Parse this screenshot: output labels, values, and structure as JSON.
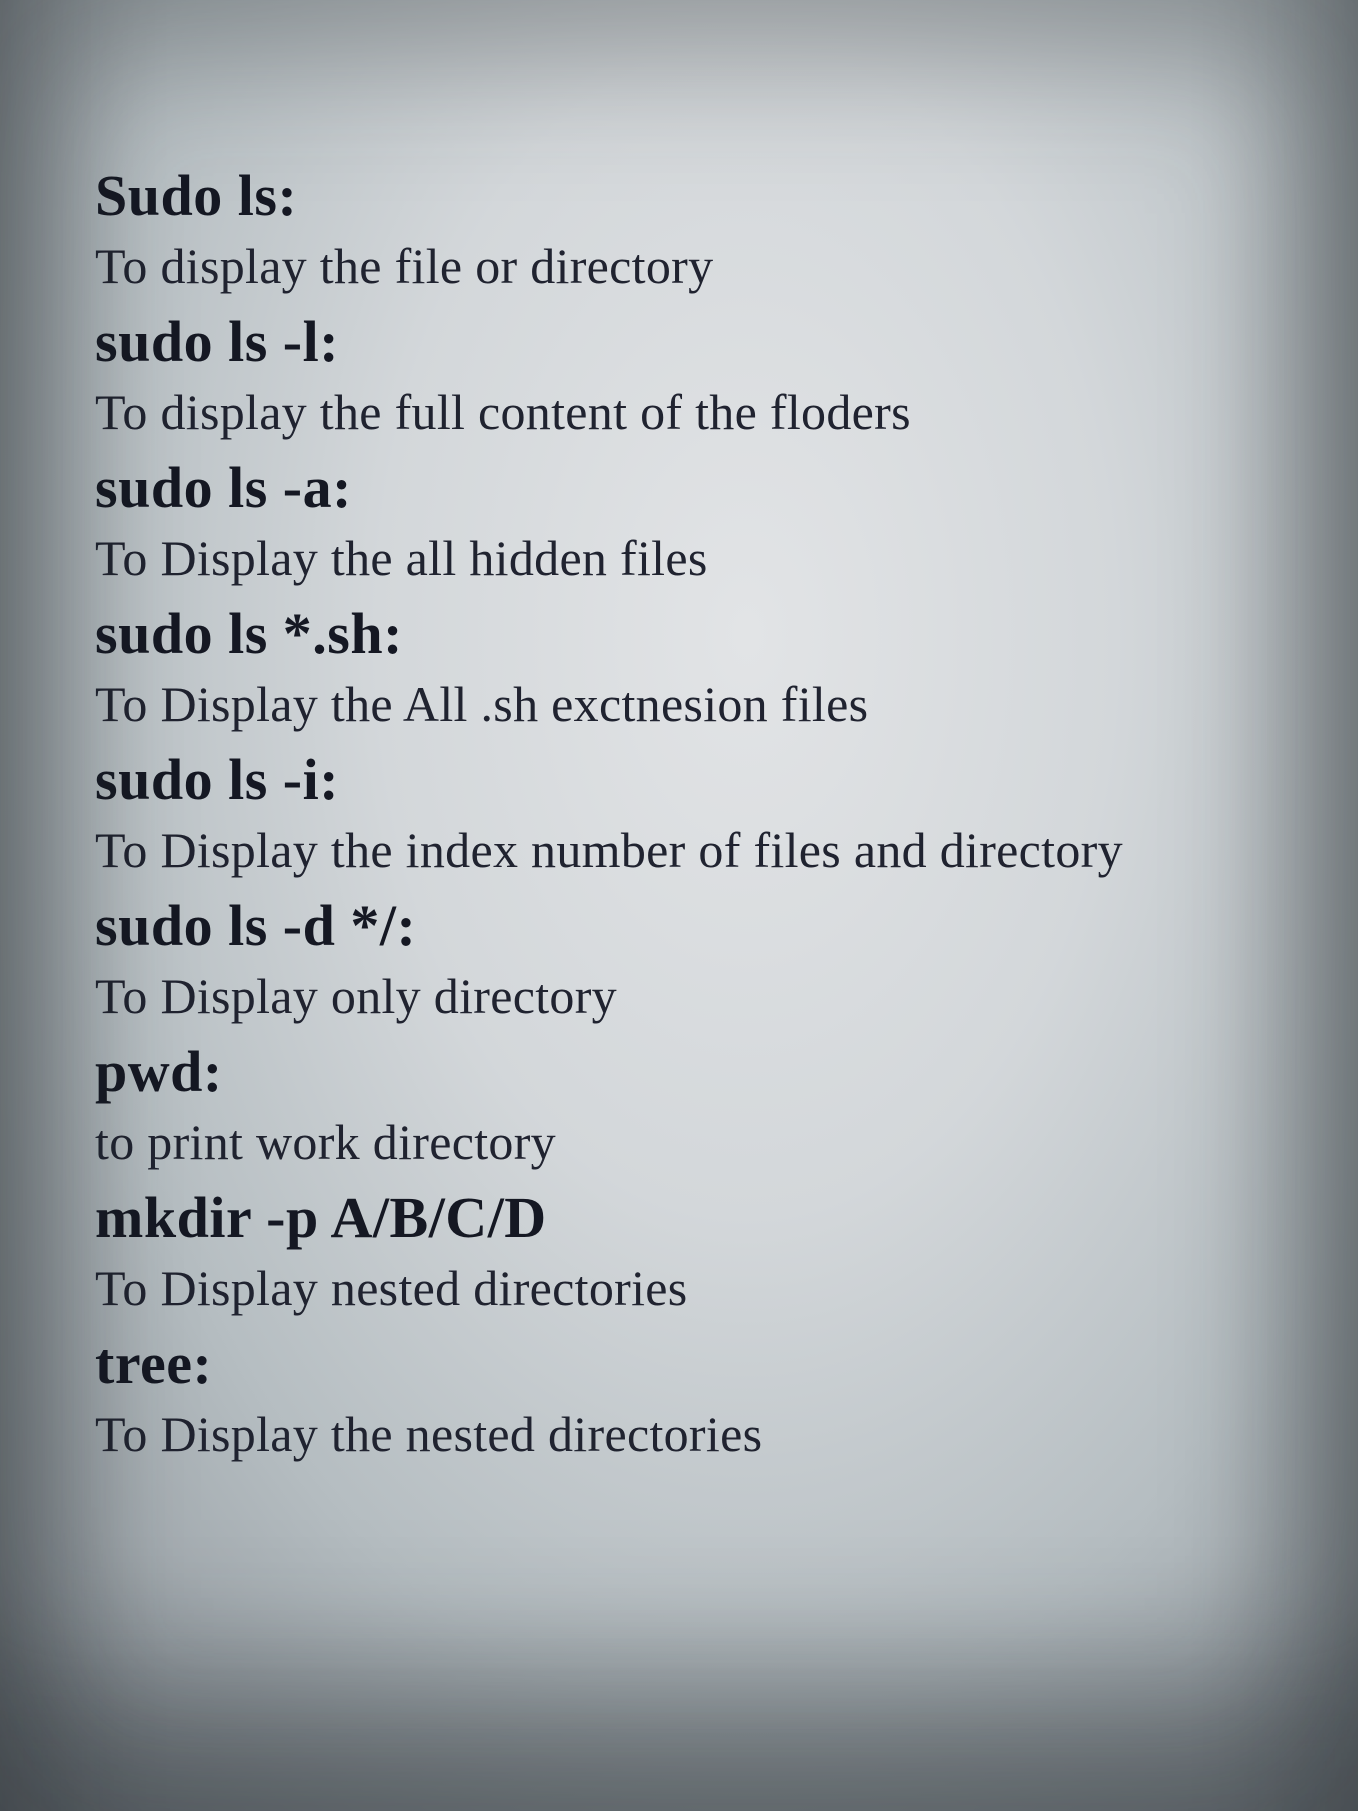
{
  "entries": [
    {
      "command": "Sudo ls:",
      "description": "To display the file or directory"
    },
    {
      "command": "sudo ls -l:",
      "description": "To display the full content of the floders"
    },
    {
      "command": "sudo ls -a:",
      "description": "To Display the all hidden files"
    },
    {
      "command": "sudo ls *.sh:",
      "description": "To Display the All .sh  exctnesion files"
    },
    {
      "command": "sudo ls -i:",
      "description": "To Display the index number of files and directory"
    },
    {
      "command": "sudo ls -d */:",
      "description": "To Display only directory"
    },
    {
      "command": "pwd:",
      "description": "to print work directory"
    },
    {
      "command": "mkdir -p A/B/C/D",
      "description": "To Display nested directories"
    },
    {
      "command": "tree:",
      "description": "To Display the nested directories"
    }
  ]
}
